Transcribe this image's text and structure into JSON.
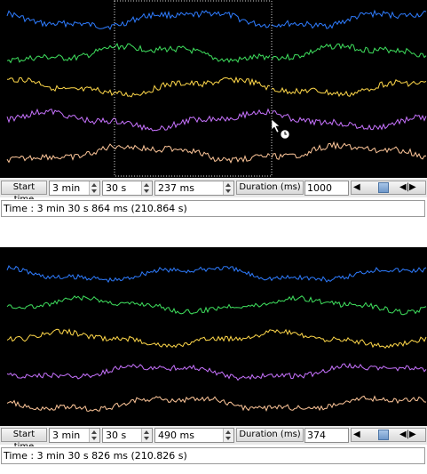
{
  "panels": [
    {
      "controls": {
        "start_time_label": "Start time",
        "minutes": "3 min",
        "seconds": "30 s",
        "milliseconds": "237 ms",
        "duration_label": "Duration (ms)",
        "duration_value": "1000",
        "nav_left": "◀",
        "nav_right": "◀|▶"
      },
      "status_text": "Time : 3 min 30 s 864 ms (210.864 s)"
    },
    {
      "controls": {
        "start_time_label": "Start time",
        "minutes": "3 min",
        "seconds": "30 s",
        "milliseconds": "490 ms",
        "duration_label": "Duration (ms)",
        "duration_value": "374",
        "nav_left": "◀",
        "nav_right": "◀|▶"
      },
      "status_text": "Time : 3 min 30 s 826 ms (210.826 s)"
    }
  ],
  "colors": {
    "channel_colors": [
      "#2e7cff",
      "#3fe05e",
      "#ffd84a",
      "#c873ff",
      "#ffc79a"
    ],
    "plot_background": "#000000"
  }
}
